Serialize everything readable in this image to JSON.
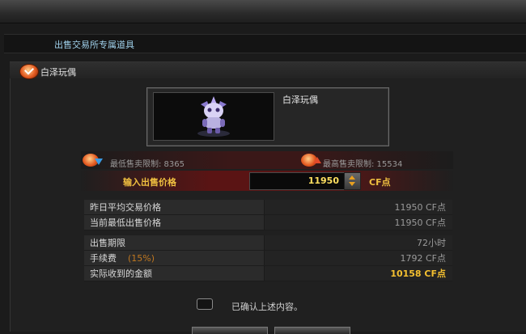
{
  "section_title": "出售交易所专属道具",
  "item": {
    "header_name": "白泽玩偶",
    "name": "白泽玩偶"
  },
  "limits": {
    "min_text": "最低售卖限制: 8365",
    "max_text": "最高售卖限制: 15534"
  },
  "price_input": {
    "label": "输入出售价格",
    "value": "11950",
    "unit": "CF点"
  },
  "market_info": [
    {
      "label": "昨日平均交易价格",
      "value": "11950 CF点"
    },
    {
      "label": "当前最低出售价格",
      "value": "11950 CF点"
    }
  ],
  "sale_info": {
    "period_label": "出售期限",
    "period_value": "72小时",
    "fee_label": "手续费",
    "fee_percent": "(15%)",
    "fee_value": "1792 CF点",
    "total_label": "实际收到的金额",
    "total_value": "10158 CF点"
  },
  "confirm": {
    "label": "已确认上述内容。"
  },
  "colors": {
    "accent_gold": "#f0c040",
    "title_blue": "#9fd0ea",
    "row_red": "#5a1414"
  }
}
